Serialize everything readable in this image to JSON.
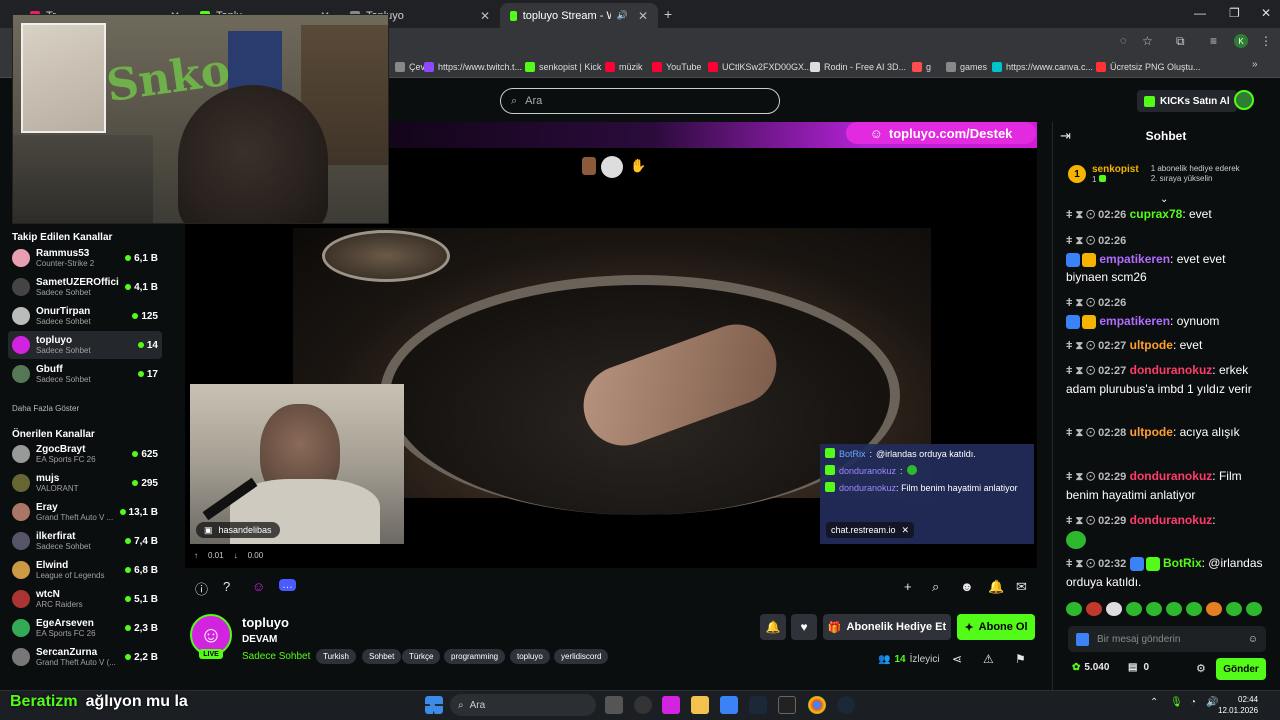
{
  "browser": {
    "tabs": [
      {
        "label": "Tr...",
        "active": false
      },
      {
        "label": "Toplu...",
        "active": false
      },
      {
        "label": "topluyo Stream - Watch Liv",
        "active": true
      }
    ],
    "partial_tab_label": "Topluyo",
    "bookmarks": [
      {
        "label": "Çevir",
        "color": "#888888"
      },
      {
        "label": "https://www.twitch.t...",
        "color": "#9146ff"
      },
      {
        "label": "senkopist | Kick",
        "color": "#53fc18"
      },
      {
        "label": "müzik",
        "color": "#ff0033"
      },
      {
        "label": "YouTube",
        "color": "#ff0033"
      },
      {
        "label": "UCtlKSw2FXD00GX...",
        "color": "#ff0033"
      },
      {
        "label": "Rodin - Free AI 3D...",
        "color": "#dddddd"
      },
      {
        "label": "g",
        "color": "#ff4d4d"
      },
      {
        "label": "games",
        "color": "#888888"
      },
      {
        "label": "https://www.canva.c...",
        "color": "#00c4cc"
      },
      {
        "label": "Ücretsiz PNG Oluştu...",
        "color": "#ff3333"
      }
    ]
  },
  "header": {
    "search_placeholder": "Ara",
    "kicks_button": "KICKs Satın Al"
  },
  "sidebar": {
    "followed_title": "Takip Edilen Kanallar",
    "followed": [
      {
        "name": "Rammus53",
        "sub": "Counter-Strike 2",
        "viewers": "6,1 B",
        "color": "#e8a0b0"
      },
      {
        "name": "SametUZEROfficial",
        "sub": "Sadece Sohbet",
        "viewers": "4,1 B",
        "color": "#444444"
      },
      {
        "name": "OnurTirpan",
        "sub": "Sadece Sohbet",
        "viewers": "125",
        "color": "#bbbbbb"
      },
      {
        "name": "topluyo",
        "sub": "Sadece Sohbet",
        "viewers": "14",
        "color": "#d224e0"
      },
      {
        "name": "Gbuff",
        "sub": "Sadece Sohbet",
        "viewers": "17",
        "color": "#557755"
      }
    ],
    "more_label": "Daha Fazla Göster",
    "recommended_title": "Önerilen Kanallar",
    "recommended": [
      {
        "name": "ZgocBrayt",
        "sub": "EA Sports FC 26",
        "viewers": "625",
        "color": "#999999"
      },
      {
        "name": "mujs",
        "sub": "VALORANT",
        "viewers": "295",
        "color": "#666633"
      },
      {
        "name": "Eray",
        "sub": "Grand Theft Auto V ...",
        "viewers": "13,1 B",
        "color": "#aa7766"
      },
      {
        "name": "ilkerfirat",
        "sub": "Sadece Sohbet",
        "viewers": "7,4 B",
        "color": "#555566"
      },
      {
        "name": "Elwind",
        "sub": "League of Legends",
        "viewers": "6,8 B",
        "color": "#cc9944"
      },
      {
        "name": "wtcN",
        "sub": "ARC Raiders",
        "viewers": "5,1 B",
        "color": "#aa3333"
      },
      {
        "name": "EgeArseven",
        "sub": "EA Sports FC 26",
        "viewers": "2,3 B",
        "color": "#33aa55"
      },
      {
        "name": "SercanZurna",
        "sub": "Grand Theft Auto V (...",
        "viewers": "2,2 B",
        "color": "#777777"
      }
    ]
  },
  "stream": {
    "destek_banner": "topluyo.com/Destek",
    "guest_label": "hasandelibas",
    "restream_label": "chat.restream.io",
    "overlay_chat": [
      {
        "user": "BotRix",
        "text": "@irlandas orduya katıldı."
      },
      {
        "user": "donduranokuz",
        "text": ""
      },
      {
        "user": "donduranokuz",
        "text": "Film benim hayatimi anlatiyor"
      }
    ],
    "up_stat": "0.01",
    "down_stat": "0.00"
  },
  "channel": {
    "name": "topluyo",
    "title": "DEVAM",
    "category": "Sadece Sohbet",
    "live_badge": "LIVE",
    "tags": [
      "Turkish",
      "Sohbet",
      "Türkçe",
      "programming",
      "topluyo",
      "yerlidiscord"
    ],
    "gift_button": "Abonelik Hediye Et",
    "subscribe_button": "Abone Ol",
    "viewer_count": "14",
    "viewer_label": "İzleyici"
  },
  "chat": {
    "title": "Sohbet",
    "pinned_user": "senkopist",
    "pinned_rank": "1",
    "pinned_text": "1 abonelik hediye ederek 2. sıraya yükselin",
    "messages": [
      {
        "time": "02:26",
        "user": "cuprax78",
        "color": "#53fc18",
        "text": "evet"
      },
      {
        "time": "02:26",
        "user": "empatikeren",
        "color": "#b06cff",
        "text": "evet evet biynaen scm26"
      },
      {
        "time": "02:26",
        "user": "empatikeren",
        "color": "#b06cff",
        "text": "oynuom"
      },
      {
        "time": "02:27",
        "user": "ultpode",
        "color": "#ff9d2e",
        "text": "evet"
      },
      {
        "time": "02:27",
        "user": "donduranokuz",
        "color": "#ff3b6b",
        "text": "erkek adam plurubus'a imbd 1 yıldız verir"
      },
      {
        "time": "02:28",
        "user": "ultpode",
        "color": "#ff9d2e",
        "text": "acıya alışık"
      },
      {
        "time": "02:29",
        "user": "donduranokuz",
        "color": "#ff3b6b",
        "text": "Film benim hayatimi anlatiyor"
      },
      {
        "time": "02:29",
        "user": "donduranokuz",
        "color": "#ff3b6b",
        "text": ""
      },
      {
        "time": "02:32",
        "user": "BotRix",
        "color": "#53fc18",
        "text": "@irlandas orduya katıldı."
      }
    ],
    "input_placeholder": "Bir mesaj gönderin",
    "points": "5.040",
    "chest_count": "0",
    "send_button": "Gönder"
  },
  "taskbar": {
    "search_placeholder": "Ara",
    "time": "02:44",
    "date": "12.01.2026"
  },
  "overlay": {
    "name": "Beratizm",
    "text": "ağlıyon mu la"
  },
  "colors": {
    "accent": "#53fc18",
    "brand_purple": "#d224e0",
    "bg": "#0b0e0f"
  }
}
